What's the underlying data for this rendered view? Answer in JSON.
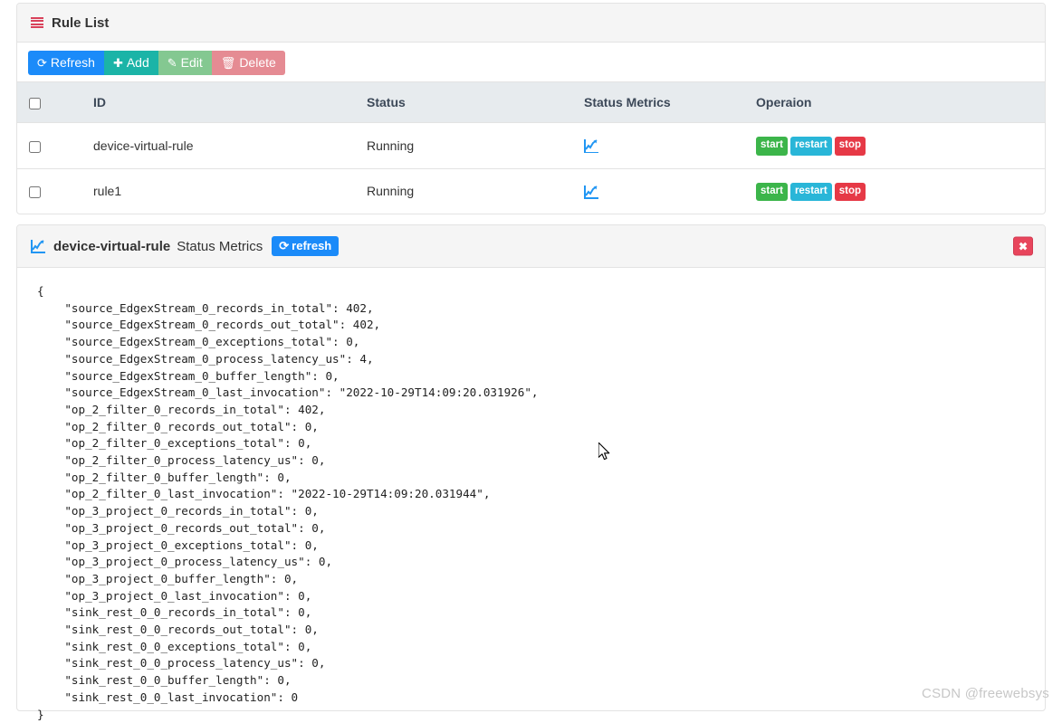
{
  "rule_list_panel": {
    "title": "Rule List",
    "icon": "list-icon",
    "toolbar": {
      "refresh_label": "Refresh",
      "refresh_icon": "refresh-icon",
      "add_label": "Add",
      "add_icon": "plus-icon",
      "edit_label": "Edit",
      "edit_icon": "pencil-square-icon",
      "delete_label": "Delete",
      "delete_icon": "trash-icon"
    },
    "table": {
      "columns": [
        "",
        "ID",
        "Status",
        "Status Metrics",
        "Operaion"
      ],
      "rows": [
        {
          "id": "device-virtual-rule",
          "status": "Running",
          "metrics_icon": "line-chart-icon",
          "operations": [
            "start",
            "restart",
            "stop"
          ]
        },
        {
          "id": "rule1",
          "status": "Running",
          "metrics_icon": "line-chart-icon",
          "operations": [
            "start",
            "restart",
            "stop"
          ]
        }
      ]
    }
  },
  "metrics_panel": {
    "icon": "line-chart-icon",
    "rule_name": "device-virtual-rule",
    "subtitle": "Status Metrics",
    "refresh_label": "refresh",
    "refresh_icon": "refresh-icon",
    "close_icon": "close-x-icon",
    "json_text": "{\n    \"source_EdgexStream_0_records_in_total\": 402,\n    \"source_EdgexStream_0_records_out_total\": 402,\n    \"source_EdgexStream_0_exceptions_total\": 0,\n    \"source_EdgexStream_0_process_latency_us\": 4,\n    \"source_EdgexStream_0_buffer_length\": 0,\n    \"source_EdgexStream_0_last_invocation\": \"2022-10-29T14:09:20.031926\",\n    \"op_2_filter_0_records_in_total\": 402,\n    \"op_2_filter_0_records_out_total\": 0,\n    \"op_2_filter_0_exceptions_total\": 0,\n    \"op_2_filter_0_process_latency_us\": 0,\n    \"op_2_filter_0_buffer_length\": 0,\n    \"op_2_filter_0_last_invocation\": \"2022-10-29T14:09:20.031944\",\n    \"op_3_project_0_records_in_total\": 0,\n    \"op_3_project_0_records_out_total\": 0,\n    \"op_3_project_0_exceptions_total\": 0,\n    \"op_3_project_0_process_latency_us\": 0,\n    \"op_3_project_0_buffer_length\": 0,\n    \"op_3_project_0_last_invocation\": 0,\n    \"sink_rest_0_0_records_in_total\": 0,\n    \"sink_rest_0_0_records_out_total\": 0,\n    \"sink_rest_0_0_exceptions_total\": 0,\n    \"sink_rest_0_0_process_latency_us\": 0,\n    \"sink_rest_0_0_buffer_length\": 0,\n    \"sink_rest_0_0_last_invocation\": 0\n}"
  },
  "watermark": "CSDN @freewebsys",
  "colors": {
    "refresh_blue": "#1b8bf9",
    "add_teal": "#1bb4a7",
    "edit_green": "#84c891",
    "delete_red": "#e58b93",
    "badge_start": "#3cb54a",
    "badge_restart": "#29b6d8",
    "badge_stop": "#e63946",
    "close_red": "#e8455c",
    "list_icon_red": "#d9415a",
    "chart_icon_blue": "#2196f3",
    "table_header_bg": "#e7ebee",
    "panel_head_bg": "#f5f5f5"
  }
}
